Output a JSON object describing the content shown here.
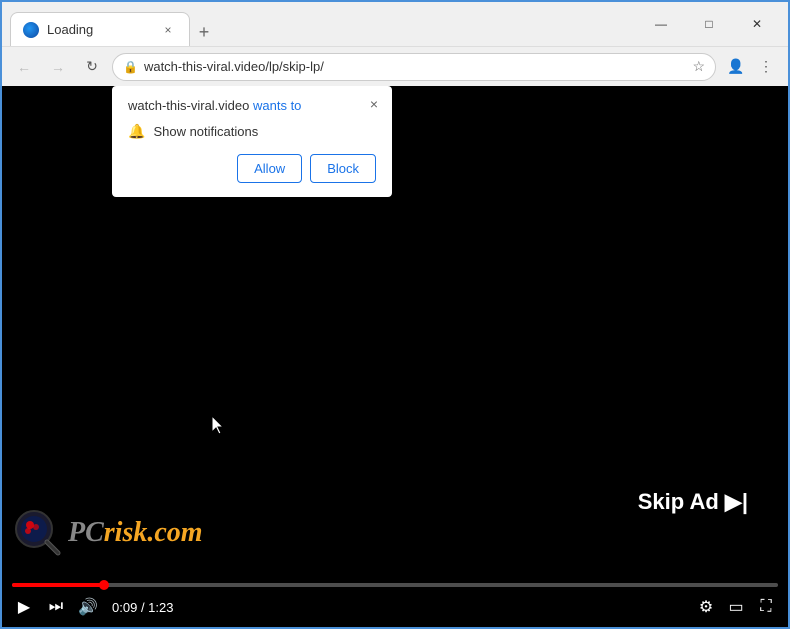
{
  "browser": {
    "title": "Loading",
    "tab": {
      "favicon_alt": "tab-favicon",
      "title": "Loading",
      "close_label": "×"
    },
    "new_tab_label": "+",
    "window_controls": {
      "minimize": "—",
      "maximize": "□",
      "close": "✕"
    },
    "toolbar": {
      "back_label": "←",
      "forward_label": "→",
      "reload_label": "↻",
      "url": "watch-this-viral.video/lp/skip-lp/",
      "star_label": "☆",
      "profile_label": "👤",
      "menu_label": "⋮"
    }
  },
  "notification_dialog": {
    "origin": "watch-this-viral.video",
    "wants_to": "wants to",
    "notification_row": "Show notifications",
    "allow_label": "Allow",
    "block_label": "Block",
    "close_label": "×"
  },
  "video": {
    "skip_ad_label": "Skip Ad ▶|",
    "progress_current": "0:09",
    "progress_total": "1:23",
    "progress_percent": 12,
    "watermark": {
      "pc_text": "PC",
      "risk_text": "risk.com"
    },
    "controls": {
      "play_label": "▶",
      "next_label": "⏭",
      "volume_label": "🔊",
      "settings_label": "⚙",
      "theater_label": "▭",
      "fullscreen_label": "⛶"
    }
  },
  "colors": {
    "accent_blue": "#1a73e8",
    "progress_red": "#f00",
    "skip_ad_bg": "rgba(0,0,0,0.75)",
    "pcrisk_orange": "#f5a623"
  }
}
